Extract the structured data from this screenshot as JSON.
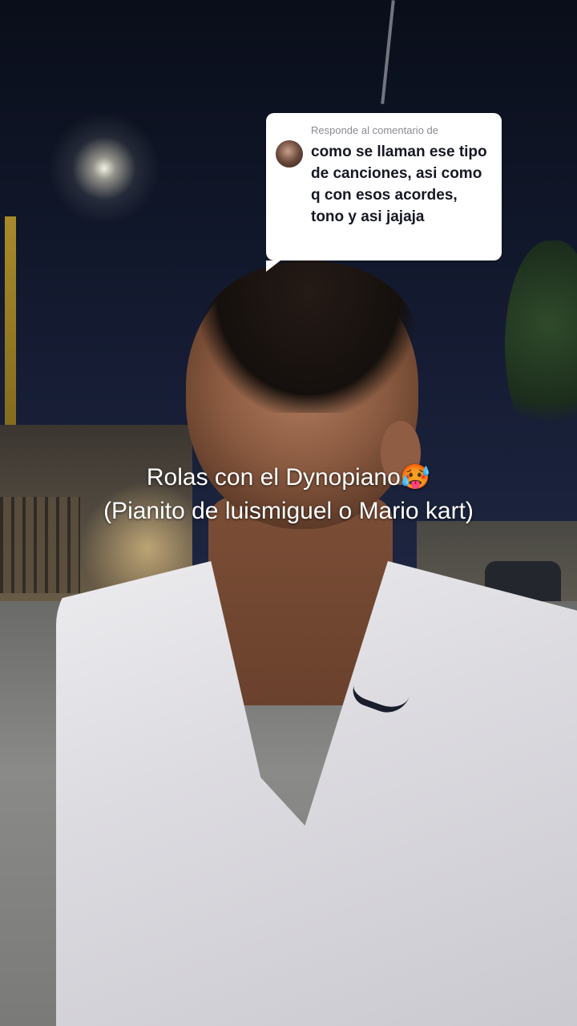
{
  "reply_card": {
    "header": "Responde al comentario de",
    "comment": "como se llaman ese tipo de canciones, asi como q con esos acordes, tono y asi jajaja"
  },
  "caption": {
    "line1": "Rolas con el Dynopiano🥵",
    "line2": "(Pianito de luismiguel o Mario kart)"
  },
  "colors": {
    "card_bg": "#ffffff",
    "card_text": "#161823",
    "card_muted": "#8a8b91",
    "caption_text": "#ffffff"
  },
  "scene_icons": {
    "avatar": "commenter-avatar"
  }
}
